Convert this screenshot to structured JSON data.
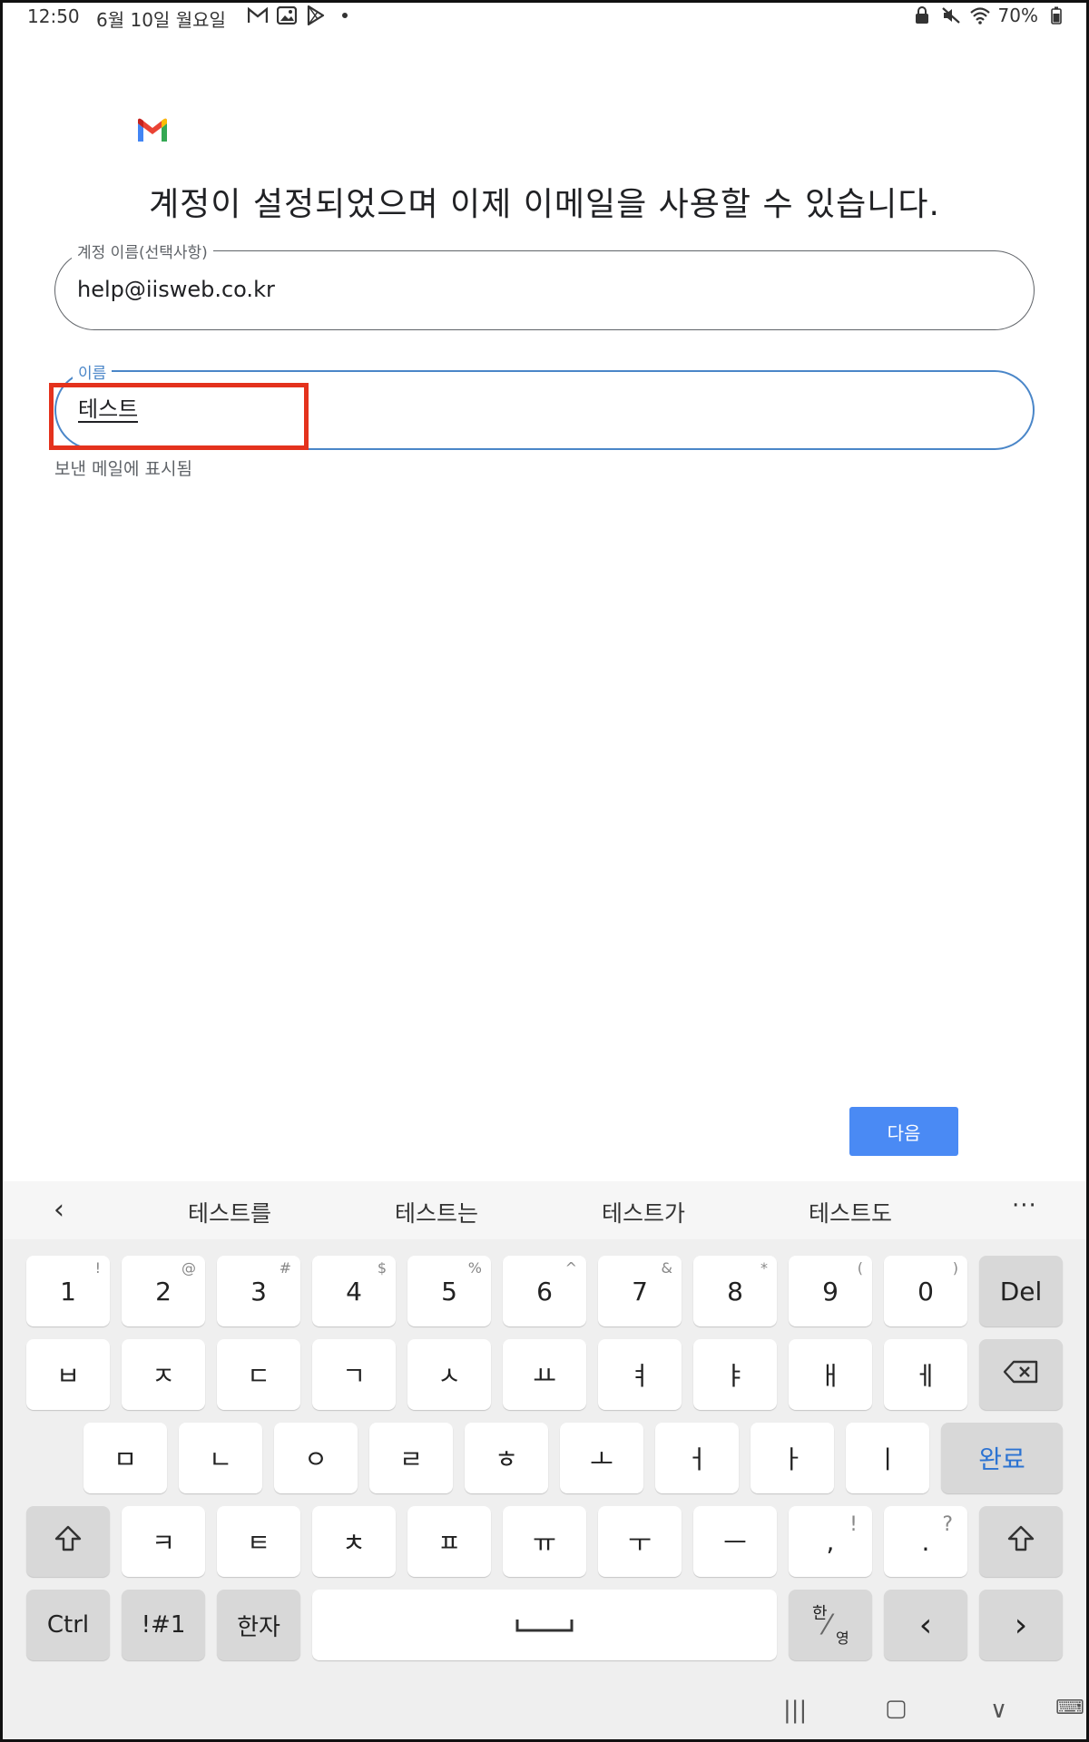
{
  "status_bar": {
    "time": "12:50",
    "date": "6월 10일 월요일",
    "battery": "70%",
    "left_icons": [
      "gmail-icon",
      "gallery-icon",
      "play-store-icon",
      "dot-icon"
    ],
    "right_icons": [
      "lock-icon",
      "mute-icon",
      "wifi-icon"
    ]
  },
  "app": {
    "logo": "gmail-logo",
    "title": "계정이 설정되었으며 이제 이메일을 사용할 수 있습니다.",
    "account_field": {
      "label": "계정 이름(선택사항)",
      "value": "help@iisweb.co.kr"
    },
    "name_field": {
      "label": "이름",
      "value": "테스트",
      "helper": "보낸 메일에 표시됨"
    },
    "next_button": "다음"
  },
  "colors": {
    "accent": "#4a86c8",
    "button": "#4a8af4",
    "highlight": "#e4321d"
  },
  "keyboard": {
    "back_icon": "‹",
    "suggestions": [
      "테스트를",
      "테스트는",
      "테스트가",
      "테스트도"
    ],
    "more": "···",
    "row1": [
      {
        "k": "1",
        "s": "!"
      },
      {
        "k": "2",
        "s": "@"
      },
      {
        "k": "3",
        "s": "#"
      },
      {
        "k": "4",
        "s": "$"
      },
      {
        "k": "5",
        "s": "%"
      },
      {
        "k": "6",
        "s": "^"
      },
      {
        "k": "7",
        "s": "&"
      },
      {
        "k": "8",
        "s": "*"
      },
      {
        "k": "9",
        "s": "("
      },
      {
        "k": "0",
        "s": ")"
      }
    ],
    "del": "Del",
    "row2": [
      "ㅂ",
      "ㅈ",
      "ㄷ",
      "ㄱ",
      "ㅅ",
      "ㅛ",
      "ㅕ",
      "ㅑ",
      "ㅐ",
      "ㅔ"
    ],
    "row3": [
      "ㅁ",
      "ㄴ",
      "ㅇ",
      "ㄹ",
      "ㅎ",
      "ㅗ",
      "ㅓ",
      "ㅏ",
      "ㅣ"
    ],
    "done": "완료",
    "row4": [
      "ㅋ",
      "ㅌ",
      "ㅊ",
      "ㅍ",
      "ㅠ",
      "ㅜ",
      "ㅡ"
    ],
    "comma": {
      "k": ",",
      "s": "!"
    },
    "period": {
      "k": ".",
      "s": "?"
    },
    "ctrl": "Ctrl",
    "sym": "!#1",
    "hanja": "한자",
    "lang_top": "한",
    "lang_bottom": "영",
    "left": "‹",
    "right": "›"
  },
  "nav_bar": {
    "recents": "|||",
    "home": "▢",
    "back": "∨",
    "keyboard": "⌨"
  }
}
